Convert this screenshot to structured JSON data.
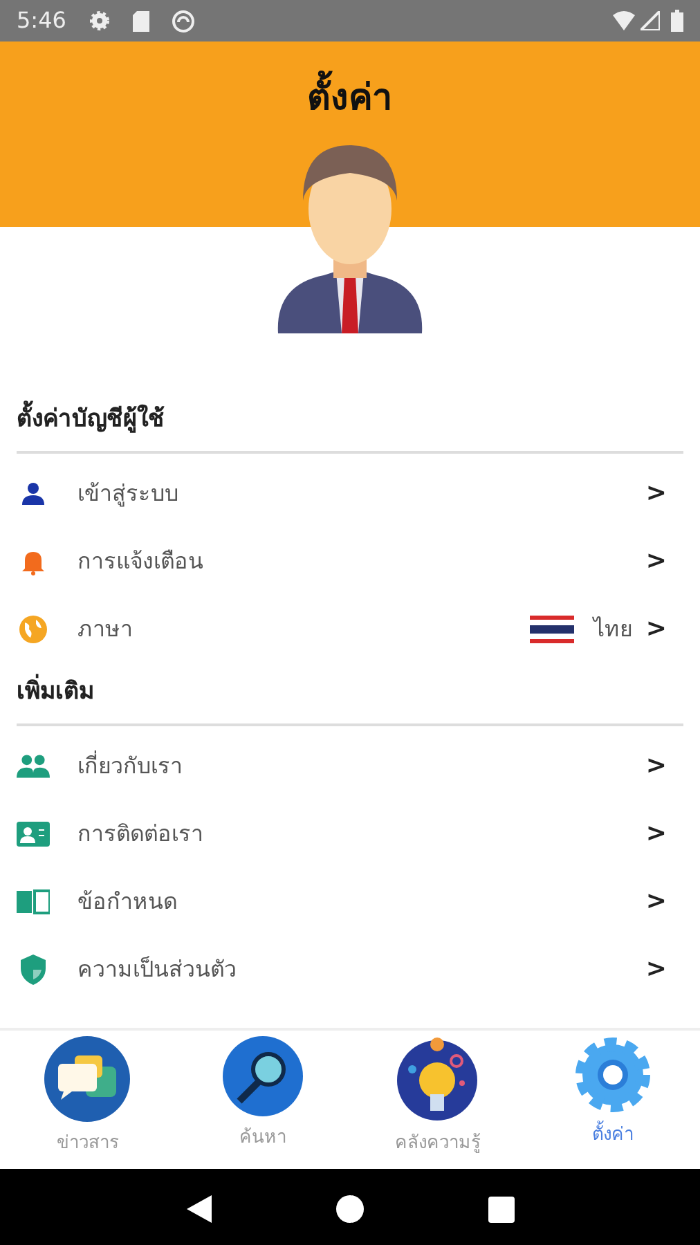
{
  "status_bar": {
    "time": "5:46"
  },
  "header": {
    "title": "ตั้งค่า"
  },
  "sections": [
    {
      "title": "ตั้งค่าบัญชีผู้ใช้",
      "items": [
        {
          "kind": "link",
          "label": "เข้าสู่ระบบ",
          "chevron": ">"
        },
        {
          "kind": "link",
          "label": "การแจ้งเตือน",
          "chevron": ">"
        },
        {
          "kind": "language",
          "label": "ภาษา",
          "value": "ไทย",
          "chevron": ">"
        }
      ]
    },
    {
      "title": "เพิ่มเติม",
      "items": [
        {
          "kind": "link",
          "label": "เกี่ยวกับเรา",
          "chevron": ">"
        },
        {
          "kind": "link",
          "label": "การติดต่อเรา",
          "chevron": ">"
        },
        {
          "kind": "link",
          "label": "ข้อกำหนด",
          "chevron": ">"
        },
        {
          "kind": "link",
          "label": "ความเป็นส่วนตัว",
          "chevron": ">"
        }
      ]
    }
  ],
  "bottom_nav": [
    {
      "label": "ข่าวสาร",
      "selected": false
    },
    {
      "label": "ค้นหา",
      "selected": false
    },
    {
      "label": "คลังความรู้",
      "selected": false
    },
    {
      "label": "ตั้งค่า",
      "selected": true
    }
  ]
}
